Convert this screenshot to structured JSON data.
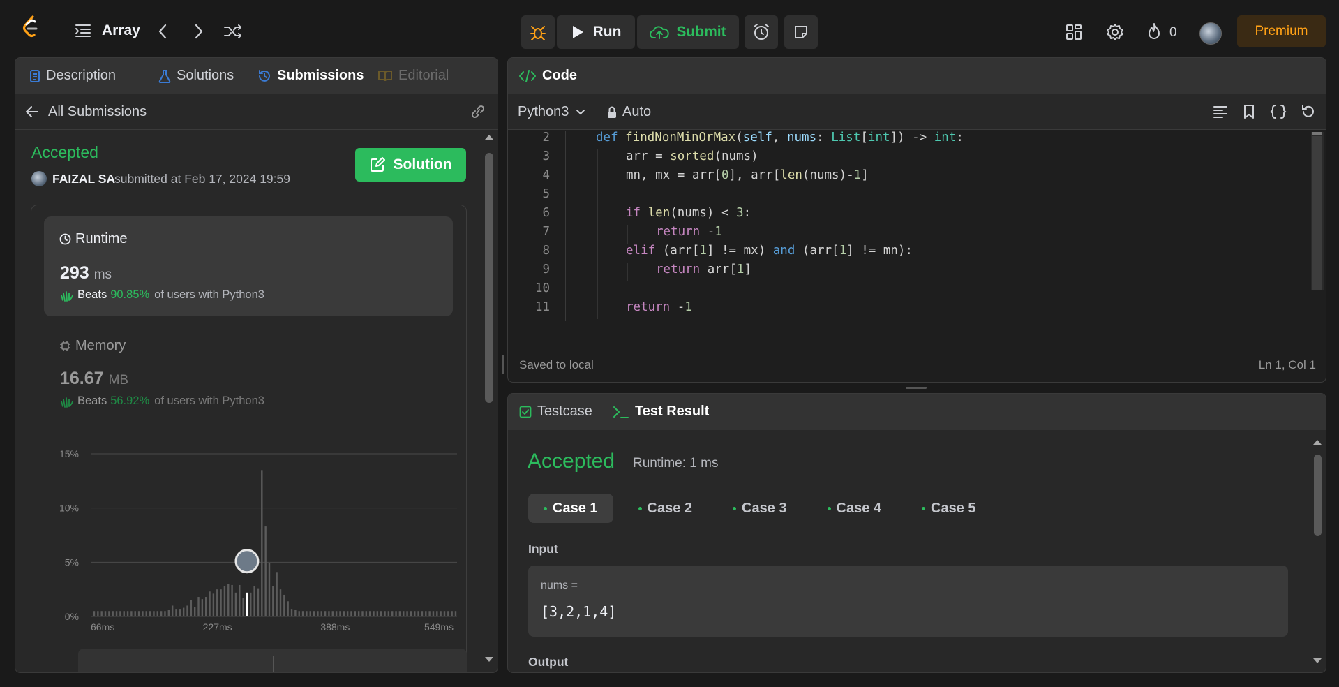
{
  "topbar": {
    "problem_list_label": "Array",
    "run_label": "Run",
    "submit_label": "Submit",
    "streak_count": "0",
    "premium_label": "Premium"
  },
  "left": {
    "tabs": [
      {
        "label": "Description"
      },
      {
        "label": "Solutions"
      },
      {
        "label": "Submissions"
      },
      {
        "label": "Editorial"
      }
    ],
    "back_label": "All Submissions",
    "status": "Accepted",
    "user_name": "FAIZAL SA",
    "submitted_text": "submitted at Feb 17, 2024 19:59",
    "solution_button": "Solution",
    "runtime": {
      "title": "Runtime",
      "value": "293",
      "unit": "ms",
      "beats_label": "Beats",
      "beats_pct": "90.85%",
      "beats_suffix": "of users with Python3"
    },
    "memory": {
      "title": "Memory",
      "value": "16.67",
      "unit": "MB",
      "beats_label": "Beats",
      "beats_pct": "56.92%",
      "beats_suffix": "of users with Python3"
    }
  },
  "chart_data": {
    "type": "bar",
    "ylabel_ticks": [
      "15%",
      "10%",
      "5%",
      "0%"
    ],
    "xlabel_ticks": [
      "66ms",
      "227ms",
      "388ms",
      "549ms"
    ],
    "ylim": [
      0,
      15
    ],
    "values": [
      0.5,
      0.5,
      0.5,
      0.5,
      0.5,
      0.5,
      0.5,
      0.5,
      0.5,
      0.5,
      0.5,
      0.5,
      0.5,
      0.5,
      0.5,
      0.5,
      0.5,
      0.5,
      0.5,
      0.5,
      0.6,
      1.0,
      0.7,
      0.7,
      0.8,
      1.0,
      1.5,
      0.9,
      1.8,
      1.6,
      1.8,
      2.3,
      2.1,
      2.5,
      2.5,
      2.8,
      3.0,
      2.9,
      2.2,
      2.9,
      1.7,
      2.2,
      2.2,
      2.8,
      2.6,
      13.5,
      8.3,
      4.9,
      2.8,
      4.1,
      2.5,
      2.0,
      1.4,
      0.7,
      0.6,
      0.5,
      0.5,
      0.5,
      0.5,
      0.5,
      0.5,
      0.5,
      0.5,
      0.5,
      0.5,
      0.5,
      0.5,
      0.5,
      0.5,
      0.5,
      0.5,
      0.5,
      0.5,
      0.5,
      0.5,
      0.5,
      0.5,
      0.5,
      0.5,
      0.5,
      0.5,
      0.5,
      0.5,
      0.5,
      0.5,
      0.5,
      0.5,
      0.5,
      0.5,
      0.5,
      0.5,
      0.5,
      0.5,
      0.5,
      0.5,
      0.5,
      0.5,
      0.5
    ],
    "highlight_index": 41,
    "grid": true
  },
  "code_panel": {
    "title": "Code",
    "language": "Python3",
    "auto_label": "Auto",
    "saved_label": "Saved to local",
    "cursor_pos": "Ln 1, Col 1",
    "line_numbers": [
      "2",
      "3",
      "4",
      "5",
      "6",
      "7",
      "8",
      "9",
      "10",
      "11"
    ]
  },
  "result_panel": {
    "tab_testcase": "Testcase",
    "tab_result": "Test Result",
    "status": "Accepted",
    "runtime": "Runtime: 1 ms",
    "cases": [
      "Case 1",
      "Case 2",
      "Case 3",
      "Case 4",
      "Case 5"
    ],
    "input_label": "Input",
    "var_label": "nums =",
    "var_value": "[3,2,1,4]",
    "output_label": "Output"
  }
}
